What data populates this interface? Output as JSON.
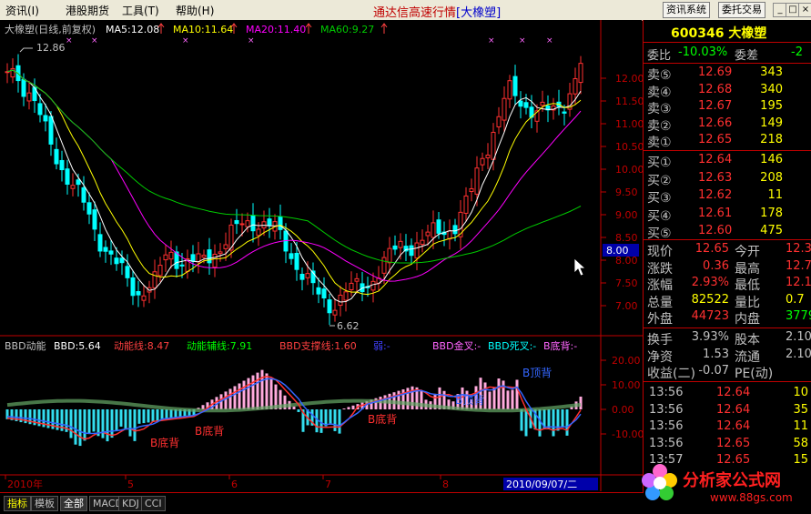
{
  "menubar": {
    "items": [
      "资讯(I)",
      "港股期货",
      "工具(T)",
      "帮助(H)"
    ],
    "title_prefix": "通达信高速行情",
    "title_stock": "[大橡塑]",
    "buttons": [
      "资讯系统",
      "委托交易"
    ],
    "win_controls": [
      "_",
      "□",
      "×"
    ]
  },
  "chart": {
    "header": {
      "title": "大橡塑(日线,前复权)",
      "ma5": "MA5:12.08",
      "ma10": "MA10:11.64",
      "ma20": "MA20:11.40",
      "ma60": "MA60:9.27"
    },
    "price_axis": [
      "12.00",
      "11.50",
      "11.00",
      "10.50",
      "10.00",
      "9.50",
      "9.00",
      "8.50",
      "8.00",
      "7.50",
      "7.00"
    ],
    "cursor_price": "8.00",
    "high_label": "12.86",
    "low_label": "6.62",
    "colors": {
      "ma5": "#ffffff",
      "ma10": "#ffff00",
      "ma20": "#ff00ff",
      "ma60": "#00cc00",
      "up": "#ff3030",
      "down": "#00ffff"
    }
  },
  "indicator": {
    "header": {
      "name": "BBD动能",
      "bbd": "BBD:5.64",
      "energy": "动能线:8.47",
      "energy_aux": "动能辅线:7.91",
      "support": "BBD支撑线:1.60",
      "weak": "弱:-",
      "golden": "BBD金叉:-",
      "death": "BBD死叉:-",
      "bottom_div": "B底背:-"
    },
    "axis": [
      "20.00",
      "10.00",
      "0.00",
      "-10.00"
    ],
    "annotations": [
      "B底背",
      "B底背",
      "B顶背",
      "B底背",
      "B顶背",
      "B顶背"
    ]
  },
  "time_axis": {
    "labels": [
      "2010年",
      "5",
      "6",
      "7",
      "8"
    ],
    "cursor_date": "2010/09/07/二"
  },
  "quote": {
    "code": "600346 大橡塑",
    "webi_label": "委比",
    "webi_value": "-10.03%",
    "weicha_label": "委差",
    "weicha_value": "-2",
    "sell": [
      {
        "label": "卖⑤",
        "price": "12.69",
        "vol": "343"
      },
      {
        "label": "卖④",
        "price": "12.68",
        "vol": "340"
      },
      {
        "label": "卖③",
        "price": "12.67",
        "vol": "195"
      },
      {
        "label": "卖②",
        "price": "12.66",
        "vol": "149"
      },
      {
        "label": "卖①",
        "price": "12.65",
        "vol": "218"
      }
    ],
    "buy": [
      {
        "label": "买①",
        "price": "12.64",
        "vol": "146"
      },
      {
        "label": "买②",
        "price": "12.63",
        "vol": "208"
      },
      {
        "label": "买③",
        "price": "12.62",
        "vol": "11"
      },
      {
        "label": "买④",
        "price": "12.61",
        "vol": "178"
      },
      {
        "label": "买⑤",
        "price": "12.60",
        "vol": "475"
      }
    ],
    "stats": [
      {
        "l1": "现价",
        "v1": "12.65",
        "l2": "今开",
        "v2": "12.3"
      },
      {
        "l1": "涨跌",
        "v1": "0.36",
        "l2": "最高",
        "v2": "12.7"
      },
      {
        "l1": "涨幅",
        "v1": "2.93%",
        "l2": "最低",
        "v2": "12.1"
      },
      {
        "l1": "总量",
        "v1": "82522",
        "l2": "量比",
        "v2": "0.7"
      },
      {
        "l1": "外盘",
        "v1": "44723",
        "l2": "内盘",
        "v2": "3779"
      }
    ],
    "stats2": [
      {
        "l1": "换手",
        "v1": "3.93%",
        "l2": "股本",
        "v2": "2.10"
      },
      {
        "l1": "净资",
        "v1": "1.53",
        "l2": "流通",
        "v2": "2.10"
      },
      {
        "l1": "收益(二)",
        "v1": "-0.07",
        "l2": "PE(动)",
        "v2": ""
      }
    ],
    "ticks": [
      {
        "time": "13:56",
        "price": "12.64",
        "vol": "10"
      },
      {
        "time": "13:56",
        "price": "12.64",
        "vol": "35"
      },
      {
        "time": "13:56",
        "price": "12.64",
        "vol": "11"
      },
      {
        "time": "13:56",
        "price": "12.65",
        "vol": "58"
      },
      {
        "time": "13:57",
        "price": "12.65",
        "vol": "15"
      }
    ]
  },
  "tabs": [
    "指标",
    "模板",
    "全部",
    "MACD",
    "KDJ",
    "CCI"
  ],
  "watermark": {
    "text": "分析家公式网",
    "url": "www.88gs.com"
  }
}
